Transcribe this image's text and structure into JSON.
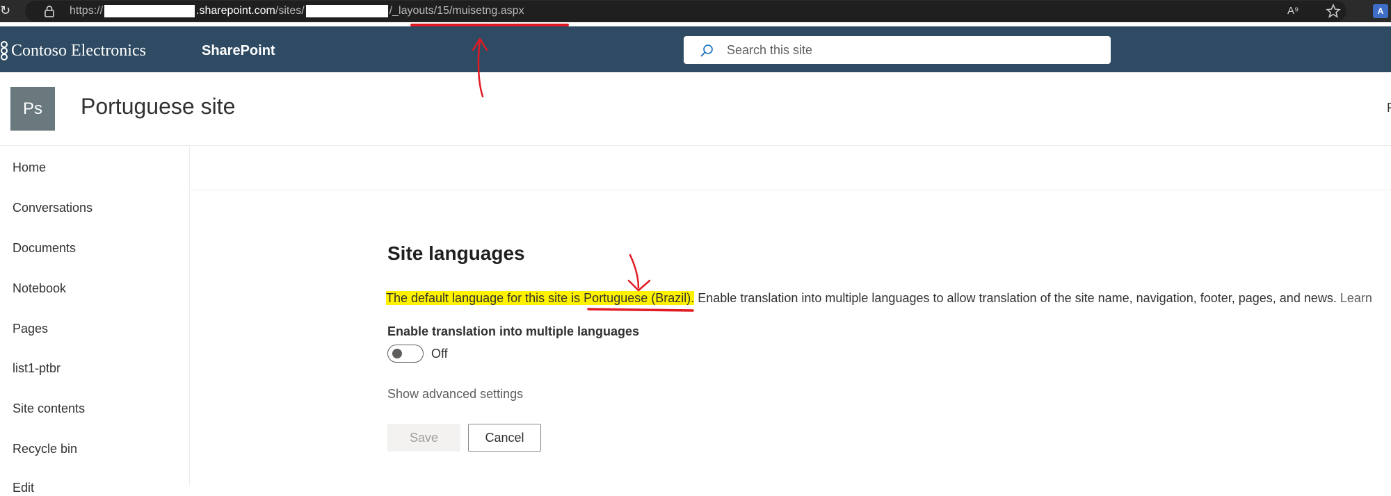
{
  "browser": {
    "url_scheme": "https://",
    "url_host": ".sharepoint.com",
    "url_sites": "/sites/",
    "url_path": "/_layouts/15/muisetng.aspx",
    "icons": [
      "refresh-icon",
      "lock-icon",
      "read-aloud-icon",
      "star-icon",
      "translate-icon"
    ]
  },
  "suite_bar": {
    "brand": "Contoso Electronics",
    "app": "SharePoint",
    "search_placeholder": "Search this site"
  },
  "site_header": {
    "logo_initials": "Ps",
    "title": "Portuguese site",
    "edge_text": "F"
  },
  "nav": {
    "items": [
      {
        "label": "Home"
      },
      {
        "label": "Conversations"
      },
      {
        "label": "Documents"
      },
      {
        "label": "Notebook"
      },
      {
        "label": "Pages"
      },
      {
        "label": "list1-ptbr"
      },
      {
        "label": "Site contents"
      },
      {
        "label": "Recycle bin"
      },
      {
        "label": "Edit"
      }
    ]
  },
  "main": {
    "section_title": "Site languages",
    "default_prefix": "The default language for this site is ",
    "default_language": "Portuguese (Brazil)",
    "default_suffix": ".",
    "description_rest": " Enable translation into multiple languages to allow translation of the site name, navigation, footer, pages, and news.",
    "learn_more": "Learn",
    "toggle_label": "Enable translation into multiple languages",
    "toggle_state": "Off",
    "advanced_link": "Show advanced settings",
    "save_label": "Save",
    "cancel_label": "Cancel"
  },
  "colors": {
    "suite_bar": "#2f4b63",
    "site_logo": "#69797e",
    "highlight": "#fff200",
    "annotation": "#e01b24"
  }
}
